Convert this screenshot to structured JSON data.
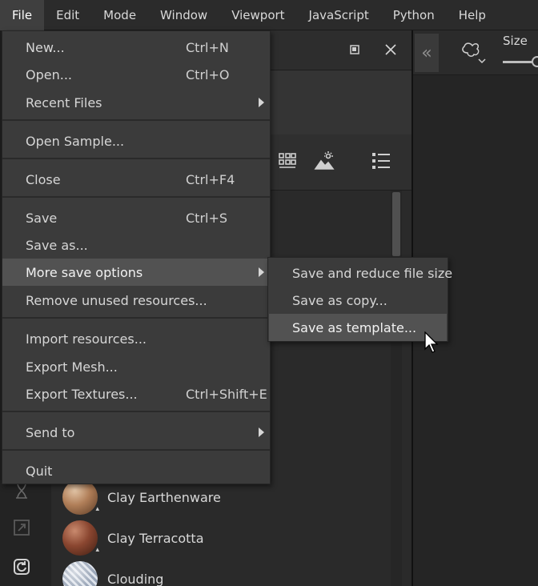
{
  "menubar": {
    "items": [
      "File",
      "Edit",
      "Mode",
      "Window",
      "Viewport",
      "JavaScript",
      "Python",
      "Help"
    ],
    "active": "File"
  },
  "file_menu": {
    "new": {
      "label": "New...",
      "shortcut": "Ctrl+N"
    },
    "open": {
      "label": "Open...",
      "shortcut": "Ctrl+O"
    },
    "recent": {
      "label": "Recent Files"
    },
    "open_sample": {
      "label": "Open Sample..."
    },
    "close": {
      "label": "Close",
      "shortcut": "Ctrl+F4"
    },
    "save": {
      "label": "Save",
      "shortcut": "Ctrl+S"
    },
    "save_as": {
      "label": "Save as..."
    },
    "more_save": {
      "label": "More save options"
    },
    "remove_unused": {
      "label": "Remove unused resources..."
    },
    "import": {
      "label": "Import resources..."
    },
    "export_mesh": {
      "label": "Export Mesh..."
    },
    "export_textures": {
      "label": "Export Textures...",
      "shortcut": "Ctrl+Shift+E"
    },
    "send_to": {
      "label": "Send to"
    },
    "quit": {
      "label": "Quit"
    }
  },
  "save_submenu": {
    "reduce": "Save and reduce file size",
    "copy": "Save as copy...",
    "template": "Save as template..."
  },
  "resources": {
    "items": [
      "Clay Earthenware",
      "Clay Terracotta",
      "Clouding"
    ]
  },
  "properties": {
    "size_label": "Size"
  },
  "colors": {
    "menu_bg": "#3b3b3b",
    "highlight": "#525252",
    "menubar_bg": "#2b2b2b",
    "panel_bg": "#2a2a2a"
  }
}
